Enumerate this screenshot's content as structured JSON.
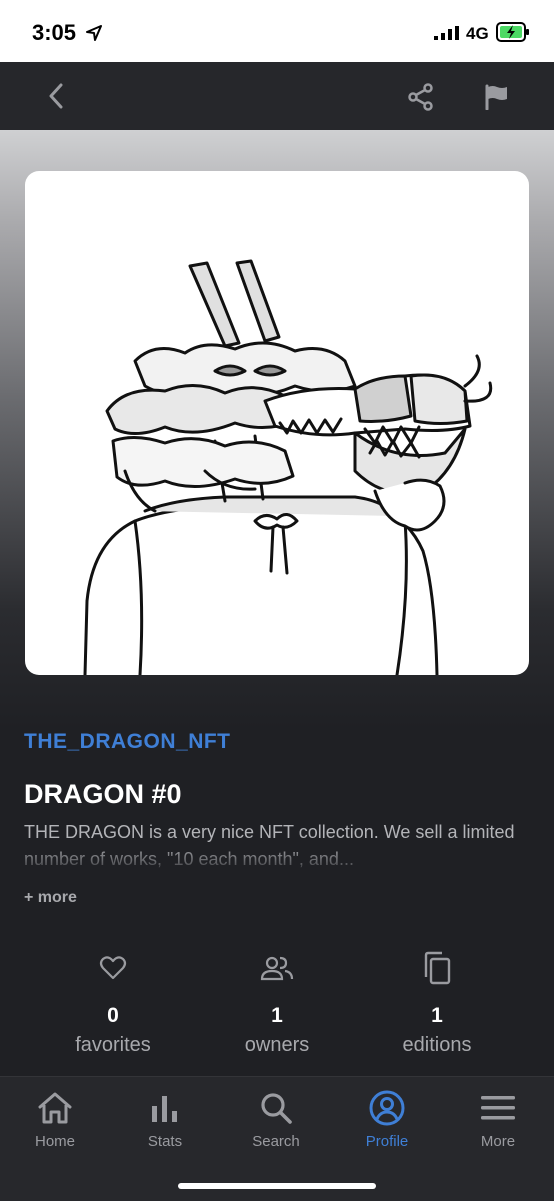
{
  "status_bar": {
    "time": "3:05",
    "network": "4G"
  },
  "collection": {
    "name": "THE_DRAGON_NFT"
  },
  "item": {
    "title": "DRAGON #0",
    "description": "THE DRAGON is a very nice NFT collection. We sell a limited number of works, \"10 each month\", and...",
    "more_label": "+ more"
  },
  "stats": {
    "favorites": {
      "value": "0",
      "label": "favorites"
    },
    "owners": {
      "value": "1",
      "label": "owners"
    },
    "editions": {
      "value": "1",
      "label": "editions"
    }
  },
  "tabs": [
    {
      "label": "Home",
      "icon": "home-icon"
    },
    {
      "label": "Stats",
      "icon": "stats-icon"
    },
    {
      "label": "Search",
      "icon": "search-icon"
    },
    {
      "label": "Profile",
      "icon": "profile-icon",
      "active": true
    },
    {
      "label": "More",
      "icon": "menu-icon"
    }
  ],
  "colors": {
    "accent": "#3f7fd6",
    "background": "#1f2024",
    "tab_bar": "#27282c",
    "battery": "#4cd964"
  }
}
